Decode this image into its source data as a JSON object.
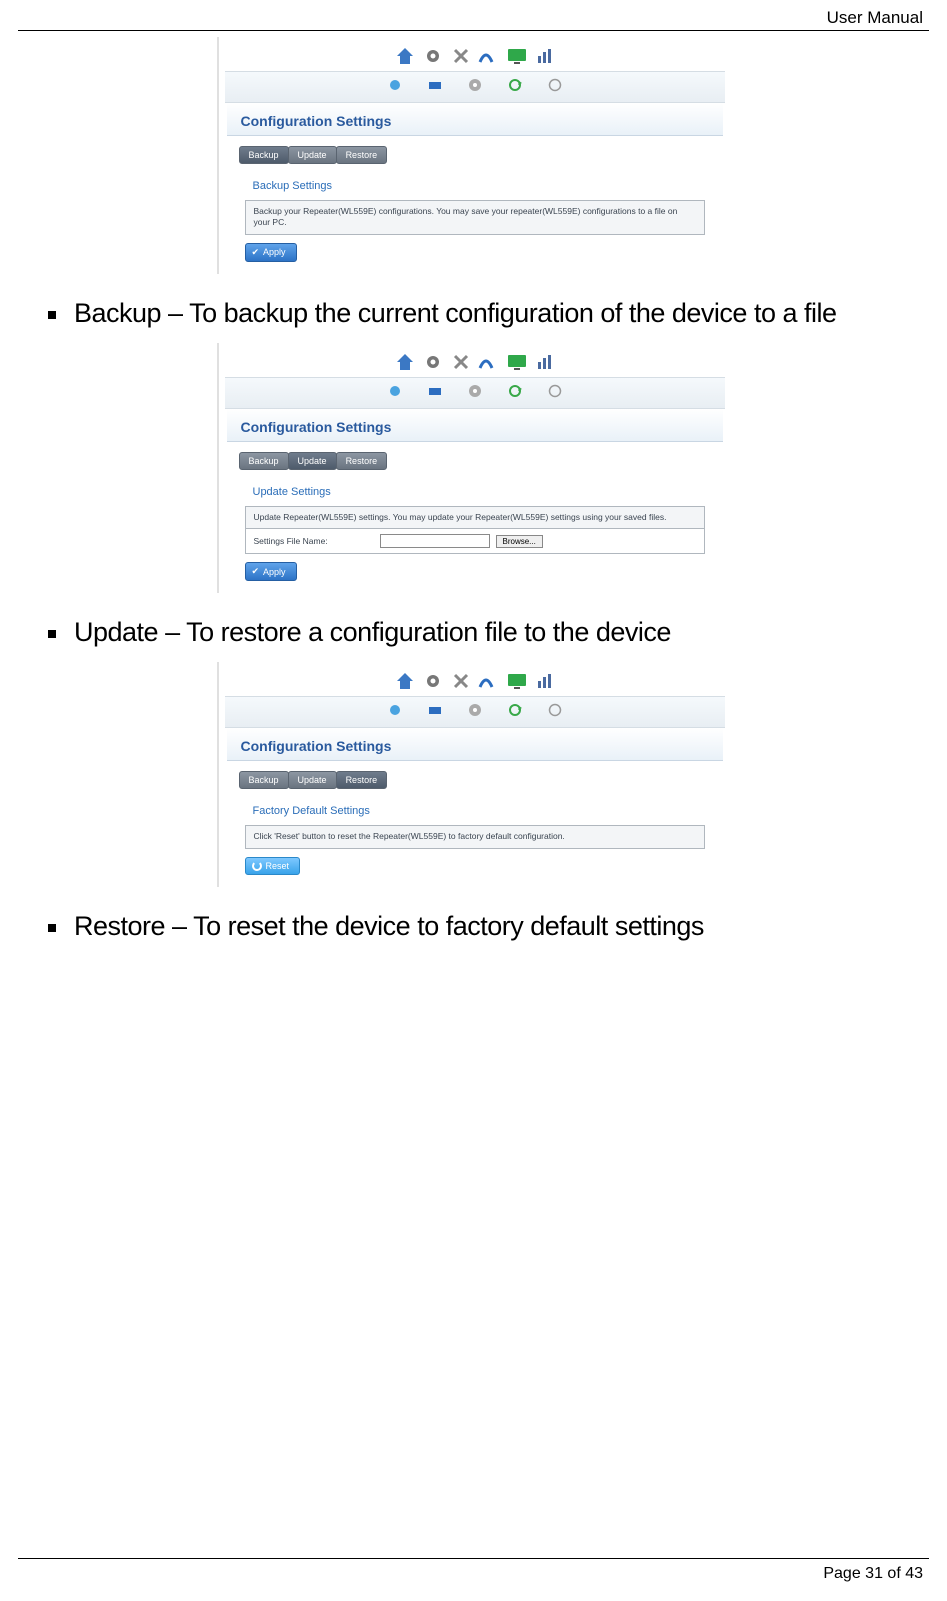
{
  "header": {
    "doc_title": "User Manual"
  },
  "footer": {
    "page_label": "Page 31 of 43"
  },
  "bullets": {
    "backup": "Backup – To backup the current configuration of the device to a file",
    "update": "Update – To restore a configuration file to the device",
    "restore": "Restore – To reset the device to factory default settings"
  },
  "router": {
    "config_title": "Configuration Settings",
    "tabs": {
      "backup": "Backup",
      "update": "Update",
      "restore": "Restore"
    },
    "shot1": {
      "section": "Backup Settings",
      "info": "Backup your Repeater(WL559E) configurations. You may save your repeater(WL559E) configurations to a file on your PC.",
      "apply": "Apply"
    },
    "shot2": {
      "section": "Update Settings",
      "info": "Update Repeater(WL559E) settings. You may update your Repeater(WL559E) settings using your saved files.",
      "file_label": "Settings File Name:",
      "browse": "Browse...",
      "apply": "Apply"
    },
    "shot3": {
      "section": "Factory Default Settings",
      "info": "Click 'Reset' button to reset the Repeater(WL559E) to factory default configuration.",
      "reset": "Reset"
    }
  }
}
